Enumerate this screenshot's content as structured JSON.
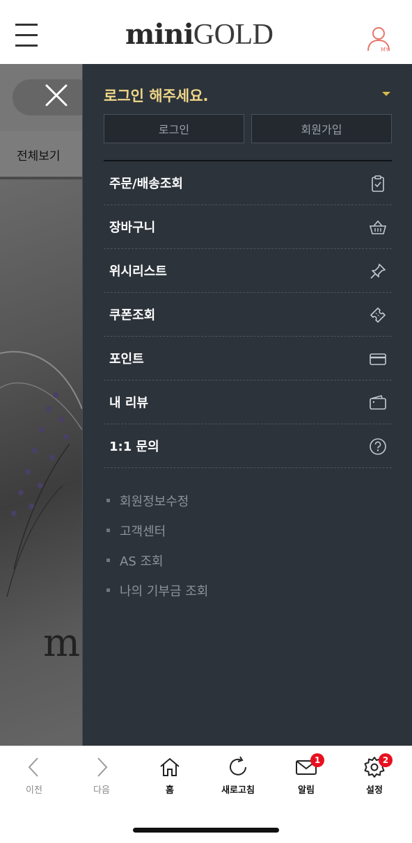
{
  "header": {
    "logo_mini": "mini",
    "logo_gold": "GOLD",
    "my_label": "MY"
  },
  "underlay": {
    "category_label": "전체보기",
    "brand_letter": "m"
  },
  "drawer": {
    "login_prompt": "로그인 해주세요.",
    "login_button": "로그인",
    "join_button": "회원가입",
    "menu": [
      {
        "label": "주문/배송조회",
        "icon": "clipboard-check-icon"
      },
      {
        "label": "장바구니",
        "icon": "basket-icon"
      },
      {
        "label": "위시리스트",
        "icon": "pin-icon"
      },
      {
        "label": "쿠폰조회",
        "icon": "ticket-icon"
      },
      {
        "label": "포인트",
        "icon": "card-icon"
      },
      {
        "label": "내 리뷰",
        "icon": "wallet-icon"
      },
      {
        "label": "1:1 문의",
        "icon": "question-circle-icon"
      }
    ],
    "sub_links": [
      "회원정보수정",
      "고객센터",
      "AS 조회",
      "나의 기부금 조회"
    ]
  },
  "bottom_nav": {
    "prev": "이전",
    "next": "다음",
    "home": "홈",
    "refresh": "새로고침",
    "notifications": "알림",
    "notifications_badge": "1",
    "settings": "설정",
    "settings_badge": "2"
  },
  "colors": {
    "drawer_bg": "#2c333a",
    "accent_gold": "#f0d68a",
    "badge_red": "#e8101f",
    "my_icon": "#e8746a"
  }
}
